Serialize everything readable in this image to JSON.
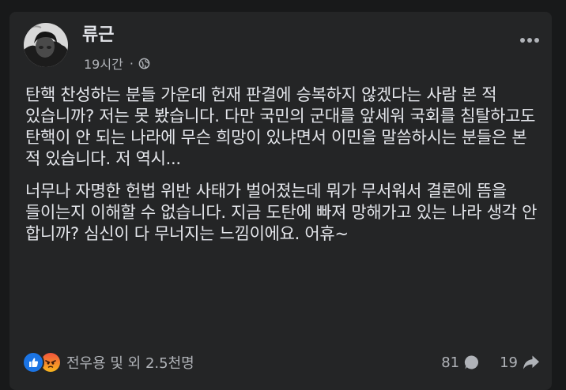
{
  "post": {
    "author": "류근",
    "time": "19시간",
    "separator": "·",
    "paragraphs": [
      "탄핵 찬성하는 분들 가운데 헌재 판결에 승복하지 않겠다는 사람 본 적 있습니까? 저는 못 봤습니다. 다만 국민의 군대를 앞세워 국회를 침탈하고도 탄핵이 안 되는 나라에 무슨 희망이 있냐면서 이민을 말씀하시는 분들은 본 적 있습니다. 저 역시...",
      "너무나 자명한 헌법 위반 사태가 벌어졌는데 뭐가 무서워서 결론에 뜸을 들이는지 이해할 수 없습니다. 지금 도탄에 빠져 망해가고 있는 나라 생각 안 합니까? 심신이 다 무너지는 느낌이에요. 어휴~"
    ]
  },
  "reactions": {
    "icons": [
      "like-icon",
      "angry-icon"
    ],
    "summary": "전우용 및 외 2.5천명"
  },
  "stats": {
    "comments": "81",
    "shares": "19"
  },
  "colors": {
    "background": "#18191a",
    "card": "#242526",
    "text_primary": "#e4e6eb",
    "text_secondary": "#b0b3b8",
    "like_blue": "#1b74e4"
  }
}
